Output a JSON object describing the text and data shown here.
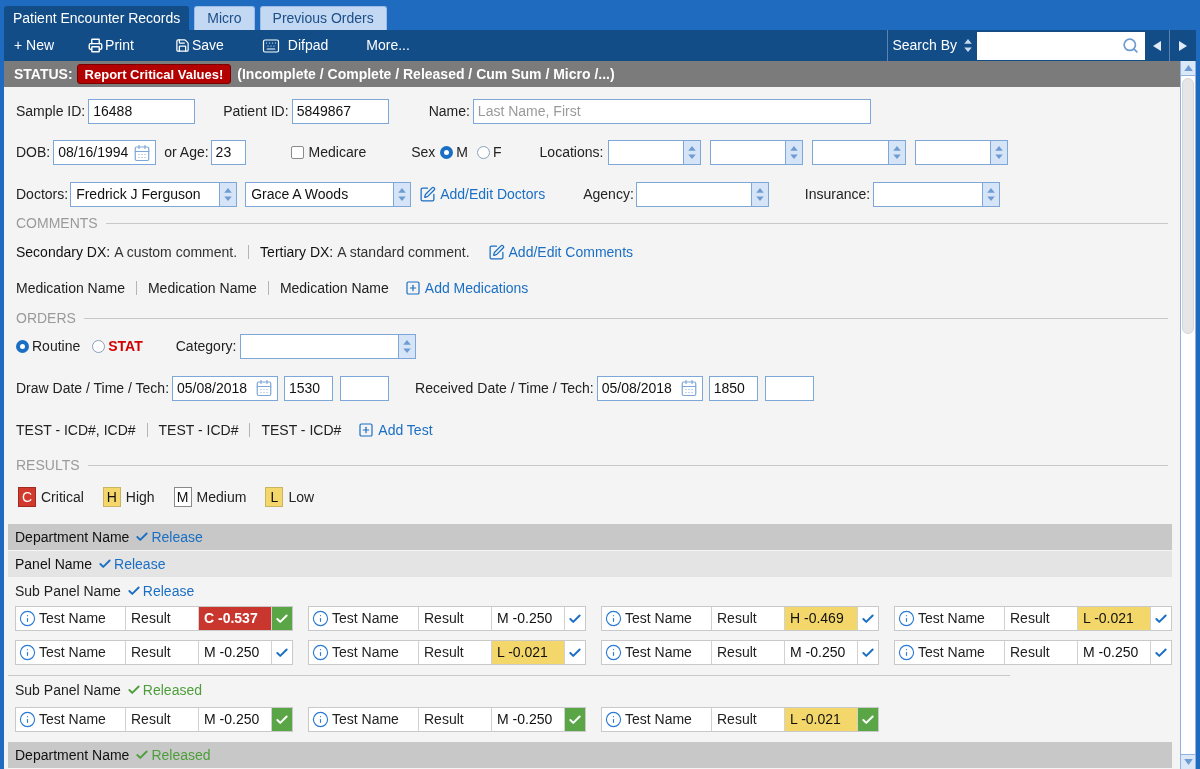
{
  "tabs": [
    {
      "label": "Patient Encounter Records",
      "selected": true
    },
    {
      "label": "Micro",
      "selected": false
    },
    {
      "label": "Previous Orders",
      "selected": false
    }
  ],
  "toolbar": {
    "new": "+ New",
    "print": "Print",
    "save": "Save",
    "difpad": "Difpad",
    "more": "More..."
  },
  "search": {
    "label": "Search By"
  },
  "status": {
    "label": "STATUS:",
    "alert_button": "Report Critical Values!",
    "states": "(Incomplete / Complete / Released / Cum Sum / Micro /...)"
  },
  "patient": {
    "sample_id": {
      "label": "Sample ID:",
      "value": "16488"
    },
    "patient_id": {
      "label": "Patient ID:",
      "value": "5849867"
    },
    "name": {
      "label": "Name:",
      "placeholder": "Last Name, First"
    },
    "dob": {
      "label": "DOB:",
      "value": "08/16/1994"
    },
    "age": {
      "label": "or Age:",
      "value": "23"
    },
    "medicare": {
      "label": "Medicare",
      "checked": false
    },
    "sex": {
      "label": "Sex",
      "options": [
        {
          "label": "M",
          "selected": true
        },
        {
          "label": "F",
          "selected": false
        }
      ]
    },
    "locations": {
      "label": "Locations:"
    },
    "doctors": {
      "label": "Doctors:",
      "values": [
        "Fredrick J Ferguson",
        "Grace A Woods"
      ],
      "link": "Add/Edit Doctors"
    },
    "agency": {
      "label": "Agency:"
    },
    "insurance": {
      "label": "Insurance:"
    }
  },
  "comments": {
    "title": "COMMENTS",
    "items": [
      {
        "label": "Secondary DX:",
        "text": "A custom comment."
      },
      {
        "label": "Tertiary DX:",
        "text": "A standard comment."
      }
    ],
    "link": "Add/Edit Comments"
  },
  "medications": {
    "items": [
      "Medication Name",
      "Medication Name",
      "Medication Name"
    ],
    "link": "Add Medications"
  },
  "orders": {
    "title": "ORDERS",
    "priority": [
      {
        "label": "Routine",
        "kind": "normal",
        "selected": true
      },
      {
        "label": "STAT",
        "kind": "urgent",
        "selected": false
      }
    ],
    "category": {
      "label": "Category:"
    },
    "draw": {
      "label": "Draw Date / Time / Tech:",
      "date": "05/08/2018",
      "time": "1530"
    },
    "received": {
      "label": "Received Date / Time / Tech:",
      "date": "05/08/2018",
      "time": "1850"
    },
    "tests": [
      "TEST - ICD#, ICD#",
      "TEST - ICD#",
      "TEST - ICD#"
    ],
    "link": "Add Test"
  },
  "results": {
    "title": "RESULTS",
    "legend": [
      {
        "letter": "C",
        "label": "Critical",
        "kind": "critical"
      },
      {
        "letter": "H",
        "label": "High",
        "kind": "high"
      },
      {
        "letter": "M",
        "label": "Medium",
        "kind": "medium"
      },
      {
        "letter": "L",
        "label": "Low",
        "kind": "low"
      }
    ],
    "departments": [
      {
        "name": "Department Name",
        "status": "Release",
        "released": false,
        "panels": [
          {
            "name": "Panel Name",
            "status": "Release",
            "released": false,
            "sub_panels": [
              {
                "name": "Sub Panel Name",
                "status": "Release",
                "released": false,
                "tests": [
                  {
                    "name": "Test Name",
                    "result": "Result",
                    "value": "C -0.537",
                    "kind": "critical",
                    "released": true
                  },
                  {
                    "name": "Test Name",
                    "result": "Result",
                    "value": "M -0.250",
                    "kind": "medium",
                    "released": false
                  },
                  {
                    "name": "Test Name",
                    "result": "Result",
                    "value": "H -0.469",
                    "kind": "high",
                    "released": false
                  },
                  {
                    "name": "Test Name",
                    "result": "Result",
                    "value": "L -0.021",
                    "kind": "low",
                    "released": false
                  },
                  {
                    "name": "Test Name",
                    "result": "Result",
                    "value": "M -0.250",
                    "kind": "medium",
                    "released": false
                  },
                  {
                    "name": "Test Name",
                    "result": "Result",
                    "value": "L -0.021",
                    "kind": "low",
                    "released": false
                  },
                  {
                    "name": "Test Name",
                    "result": "Result",
                    "value": "M -0.250",
                    "kind": "medium",
                    "released": false
                  },
                  {
                    "name": "Test Name",
                    "result": "Result",
                    "value": "M -0.250",
                    "kind": "medium",
                    "released": false
                  }
                ]
              },
              {
                "name": "Sub Panel Name",
                "status": "Released",
                "released": true,
                "tests": [
                  {
                    "name": "Test Name",
                    "result": "Result",
                    "value": "M -0.250",
                    "kind": "medium",
                    "released": true
                  },
                  {
                    "name": "Test Name",
                    "result": "Result",
                    "value": "M -0.250",
                    "kind": "medium",
                    "released": true
                  },
                  {
                    "name": "Test Name",
                    "result": "Result",
                    "value": "L -0.021",
                    "kind": "low",
                    "released": true
                  }
                ]
              }
            ]
          }
        ]
      },
      {
        "name": "Department Name",
        "status": "Released",
        "released": true
      }
    ]
  }
}
